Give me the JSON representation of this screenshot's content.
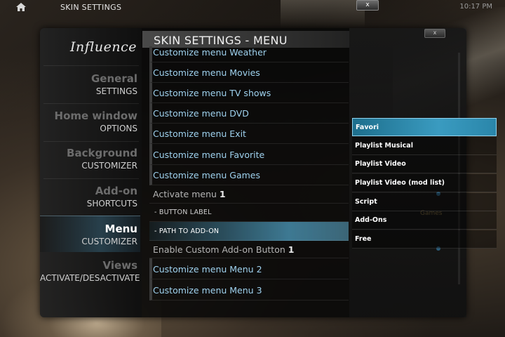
{
  "topbar": {
    "title": "SKIN SETTINGS",
    "clock": "10:17 PM",
    "close": "x"
  },
  "logo": "Influence",
  "header": {
    "title": "SKIN SETTINGS - MENU"
  },
  "sidebar": {
    "items": [
      {
        "title": "General",
        "subtitle": "SETTINGS"
      },
      {
        "title": "Home window",
        "subtitle": "OPTIONS"
      },
      {
        "title": "Background",
        "subtitle": "CUSTOMIZER"
      },
      {
        "title": "Add-on",
        "subtitle": "SHORTCUTS"
      },
      {
        "title": "Menu",
        "subtitle": "CUSTOMIZER"
      },
      {
        "title": "Views",
        "subtitle": "ACTIVATE/DESACTIVATE"
      }
    ]
  },
  "list": {
    "rows": [
      {
        "label": "Customize menu Weather"
      },
      {
        "label": "Customize menu Movies"
      },
      {
        "label": "Customize menu TV shows"
      },
      {
        "label": "Customize menu DVD"
      },
      {
        "label": "Customize menu Exit"
      },
      {
        "label": "Customize menu Favorite"
      },
      {
        "label": "Customize menu Games"
      },
      {
        "label": "Activate menu",
        "value": "1"
      },
      {
        "label": "- BUTTON LABEL"
      },
      {
        "label": "- PATH TO ADD-ON"
      },
      {
        "label": "Enable Custom Add-on Button",
        "value": "1"
      },
      {
        "label": "Customize menu Menu 2"
      },
      {
        "label": "Customize menu Menu 3"
      }
    ]
  },
  "popup": {
    "close": "x",
    "ghost_label": "Games",
    "items": [
      {
        "label": "Favori"
      },
      {
        "label": "Playlist Musical"
      },
      {
        "label": "Playlist Video"
      },
      {
        "label": "Playlist Video (mod list)"
      },
      {
        "label": "Script"
      },
      {
        "label": "Add-Ons"
      },
      {
        "label": "Free"
      }
    ]
  },
  "colors": {
    "accent": "#3a9bc0",
    "menu_link": "#9fd2ef"
  }
}
